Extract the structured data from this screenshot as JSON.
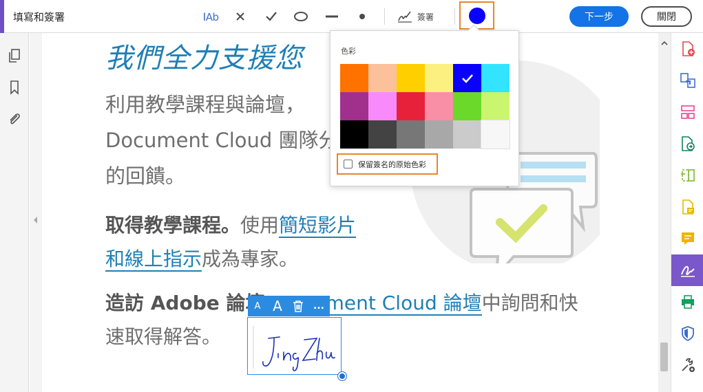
{
  "toolbar": {
    "title": "填寫和簽署",
    "tools": [
      {
        "name": "text-field-tool",
        "label": "IAb"
      },
      {
        "name": "cross-mark-tool"
      },
      {
        "name": "check-mark-tool"
      },
      {
        "name": "ellipse-tool"
      },
      {
        "name": "line-tool"
      },
      {
        "name": "dot-tool"
      }
    ],
    "sign_label": "簽署",
    "color_swatch": "#0a00ff",
    "next_label": "下一步",
    "close_label": "關閉"
  },
  "left_rail": {
    "icons": [
      "pages-icon",
      "bookmark-icon",
      "attachment-icon"
    ]
  },
  "document": {
    "heading": "我們全力支援您",
    "para1": [
      "利用教學課程與論壇，",
      "Document Cloud 團隊分",
      "的回饋。"
    ],
    "para2_bold": "取得教學課程。",
    "para2_text": "使用",
    "para2_link_1": "簡短影片",
    "para2_link_2": "和線上指示",
    "para2_tail": "成為專家。",
    "para3_bold": "造訪 Adobe 論壇",
    "para3_link": "cument Cloud 論壇",
    "para3_tail": "中詢問和快",
    "para3_line2": "速取得解答。"
  },
  "signature": {
    "toolbar": [
      "A",
      "A",
      "delete-icon",
      "..."
    ],
    "text": "Jing Zhu",
    "ink_color": "#1a2fb8"
  },
  "color_popover": {
    "title": "色彩",
    "swatches": [
      "#ff7200",
      "#fcc19a",
      "#ffcf00",
      "#fcf080",
      "#0a00ff",
      "#32e4ff",
      "#a0308c",
      "#f98afc",
      "#e8213a",
      "#f88fa6",
      "#6bd92a",
      "#c9f56f",
      "#000000",
      "#434343",
      "#777777",
      "#a8a8a8",
      "#cbcbcb",
      "#f7f7f7"
    ],
    "selected_index": 4,
    "keep_original_label": "保留簽名的原始色彩"
  },
  "right_rail": {
    "icons": [
      "create-pdf-icon",
      "combine-files-icon",
      "organize-pages-icon",
      "export-pdf-icon",
      "edit-pdf-icon",
      "comment-icon",
      "comment-note-icon",
      "fill-sign-icon",
      "print-production-icon",
      "protect-icon",
      "more-tools-icon"
    ],
    "active_index": 7
  },
  "colors": {
    "accent": "#6e4fc4",
    "primary_button": "#1473e6",
    "link": "#1e7fb5",
    "highlight_border": "#e8862c"
  }
}
